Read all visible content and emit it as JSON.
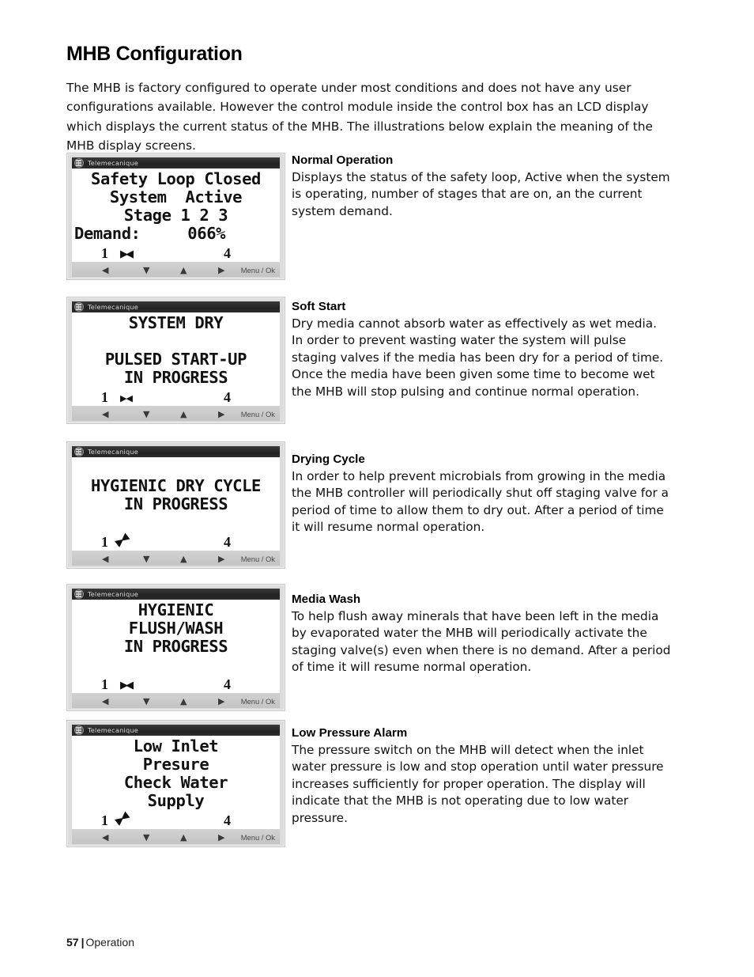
{
  "page": {
    "title": "MHB Configuration",
    "intro": "The MHB is factory configured to operate under most conditions and does not have any user configurations available. However the control module inside the control box has an LCD display which displays the current status of the MHB.  The illustrations below explain the meaning of the MHB display screens.",
    "footer": {
      "page_number": "57",
      "separator": "|",
      "section": "Operation"
    }
  },
  "device": {
    "brand": "Telemecanique",
    "logo_icon": "telemecanique-logo-icon",
    "buttons": {
      "left_icon": "◀",
      "down_icon": "▼",
      "up_icon": "▲",
      "right_icon": "▶",
      "menu_label": "Menu / Ok"
    },
    "colors": {
      "titlebar": "#2b2b2b",
      "frame": "#dcdcdc",
      "lcd": "#ffffff",
      "buttonbar": "#c9c9c9"
    }
  },
  "sections": [
    {
      "title": "Normal Operation",
      "body": "Displays the status of the safety loop, Active when the system is operating, number of stages that are on, an the current system demand.",
      "screen": {
        "lines": [
          {
            "text": "Safety Loop Closed",
            "align": "center"
          },
          {
            "text": "System  Active",
            "align": "center"
          },
          {
            "text": "Stage 1 2 3",
            "align": "center"
          },
          {
            "text": "Demand:     066%",
            "align": "left"
          }
        ],
        "softkey_left": "1",
        "softkey_right": "4",
        "softkey_glyph": "▶◀",
        "softkey_glyph_style": "stack"
      }
    },
    {
      "title": "Soft Start",
      "body": "Dry media cannot absorb water as effectively as wet media. In order to prevent wasting water the system will pulse staging valves if the media has been dry for a period of time.   Once the media have been given some time to become wet the MHB will stop pulsing and continue normal operation.",
      "screen": {
        "lines": [
          {
            "text": "SYSTEM DRY",
            "align": "center"
          },
          {
            "text": "",
            "align": "center"
          },
          {
            "text": "PULSED START-UP",
            "align": "center"
          },
          {
            "text": "IN PROGRESS",
            "align": "center"
          }
        ],
        "softkey_left": "1",
        "softkey_right": "4",
        "softkey_glyph": "▶◀",
        "softkey_glyph_style": "inward"
      }
    },
    {
      "title": "Drying Cycle",
      "body": "In order to help prevent microbials from growing in the media the MHB controller will periodically shut off staging valve for a period of time to allow them to dry out.  After a period of time it will resume normal operation.",
      "screen": {
        "lines": [
          {
            "text": "",
            "align": "center"
          },
          {
            "text": "HYGIENIC DRY CYCLE",
            "align": "center"
          },
          {
            "text": "IN PROGRESS",
            "align": "center"
          },
          {
            "text": "",
            "align": "center"
          }
        ],
        "softkey_left": "1",
        "softkey_right": "4",
        "softkey_glyph": "▶◀",
        "softkey_glyph_style": "diag"
      }
    },
    {
      "title": "Media Wash",
      "body": "To help flush away minerals that have been left in the media by evaporated water the MHB will periodically activate the staging valve(s) even when there is no demand.  After a period of time it will resume normal operation.",
      "screen": {
        "lines": [
          {
            "text": "HYGIENIC",
            "align": "center"
          },
          {
            "text": "FLUSH/WASH",
            "align": "center"
          },
          {
            "text": "IN PROGRESS",
            "align": "center"
          },
          {
            "text": "",
            "align": "center"
          }
        ],
        "softkey_left": "1",
        "softkey_right": "4",
        "softkey_glyph": "▶◀",
        "softkey_glyph_style": "stack"
      }
    },
    {
      "title": "Low Pressure Alarm",
      "body": "The pressure switch on the MHB will detect when the inlet water pressure is low and stop operation until water pressure increases sufficiently for proper operation.  The display will indicate that the MHB is not operating due to low water pressure.",
      "screen": {
        "lines": [
          {
            "text": "Low Inlet",
            "align": "center"
          },
          {
            "text": "Presure",
            "align": "center"
          },
          {
            "text": "Check Water",
            "align": "center"
          },
          {
            "text": "Supply",
            "align": "center"
          }
        ],
        "softkey_left": "1",
        "softkey_right": "4",
        "softkey_glyph": "▶◀",
        "softkey_glyph_style": "diag"
      }
    }
  ]
}
